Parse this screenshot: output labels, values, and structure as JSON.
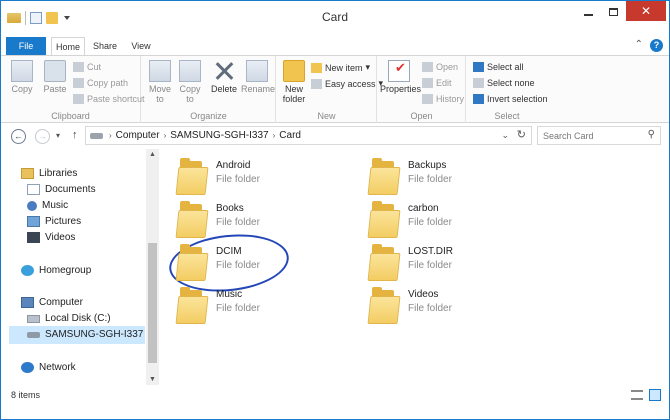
{
  "window": {
    "title": "Card"
  },
  "tabs": [
    {
      "label": "File"
    },
    {
      "label": "Home"
    },
    {
      "label": "Share"
    },
    {
      "label": "View"
    }
  ],
  "ribbon": {
    "clipboard": {
      "label": "Clipboard",
      "copy": "Copy",
      "paste": "Paste",
      "cut": "Cut",
      "copy_path": "Copy path",
      "paste_shortcut": "Paste shortcut"
    },
    "organize": {
      "label": "Organize",
      "move_to": "Move to",
      "copy_to": "Copy to",
      "delete": "Delete",
      "rename": "Rename"
    },
    "new": {
      "label": "New",
      "new_folder": "New folder",
      "new_item": "New item",
      "easy_access": "Easy access"
    },
    "open": {
      "label": "Open",
      "properties": "Properties",
      "open": "Open",
      "edit": "Edit",
      "history": "History"
    },
    "select": {
      "label": "Select",
      "select_all": "Select all",
      "select_none": "Select none",
      "invert": "Invert selection"
    }
  },
  "address": {
    "crumbs": [
      "Computer",
      "SAMSUNG-SGH-I337",
      "Card"
    ]
  },
  "search": {
    "placeholder": "Search Card"
  },
  "navpane": {
    "libraries": "Libraries",
    "documents": "Documents",
    "music": "Music",
    "pictures": "Pictures",
    "videos": "Videos",
    "homegroup": "Homegroup",
    "computer": "Computer",
    "local_disk": "Local Disk (C:)",
    "device": "SAMSUNG-SGH-I337",
    "network": "Network"
  },
  "files": [
    {
      "name": "Android",
      "type": "File folder"
    },
    {
      "name": "Backups",
      "type": "File folder"
    },
    {
      "name": "Books",
      "type": "File folder"
    },
    {
      "name": "carbon",
      "type": "File folder"
    },
    {
      "name": "DCIM",
      "type": "File folder"
    },
    {
      "name": "LOST.DIR",
      "type": "File folder"
    },
    {
      "name": "Music",
      "type": "File folder"
    },
    {
      "name": "Videos",
      "type": "File folder"
    }
  ],
  "status": {
    "items": "8 items"
  },
  "colors": {
    "accent": "#1979ca",
    "annotation": "#2447b8"
  }
}
